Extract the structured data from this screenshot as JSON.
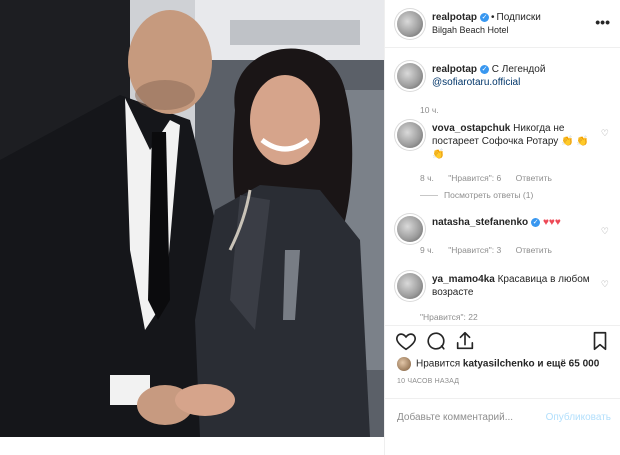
{
  "post": {
    "username": "realpotap",
    "follow_label": "Подписки",
    "location": "Bilgah Beach Hotel",
    "caption_text": "С Легендой",
    "caption_mention": "@sofiarotaru.official",
    "caption_time": "10 ч."
  },
  "comments": [
    {
      "username": "vova_ostapchuk",
      "text": "Никогда не постареет Софочка Ротару",
      "emoji": "👏 👏👏",
      "time": "8 ч.",
      "likes": "\"Нравится\": 6",
      "reply": "Ответить",
      "replies": "Посмотреть ответы (1)"
    },
    {
      "username": "natasha_stefanenko",
      "text": "",
      "emoji": "♥♥♥",
      "time": "9 ч.",
      "likes": "\"Нравится\": 3",
      "reply": "Ответить"
    },
    {
      "username": "ya_mamo4ka",
      "text": "Красавица в любом возрасте",
      "likes": "\"Нравится\": 22"
    }
  ],
  "footer": {
    "liked_by_prefix": "Нравится",
    "liked_by_user": "katyasilchenko",
    "liked_by_suffix": "и ещё 65 000",
    "time_ago": "10 ЧАСОВ НАЗАД",
    "add_comment_placeholder": "Добавьте комментарий...",
    "publish_label": "Опубликовать"
  },
  "colors": {
    "verified": "#3897f0",
    "link": "#003569",
    "muted": "#8e8e8e",
    "publish_disabled": "#b2dffc",
    "like_red": "#ed4956"
  },
  "icons": [
    "verified-icon",
    "more-options-icon",
    "heart-icon",
    "comment-icon",
    "share-icon",
    "bookmark-icon"
  ]
}
